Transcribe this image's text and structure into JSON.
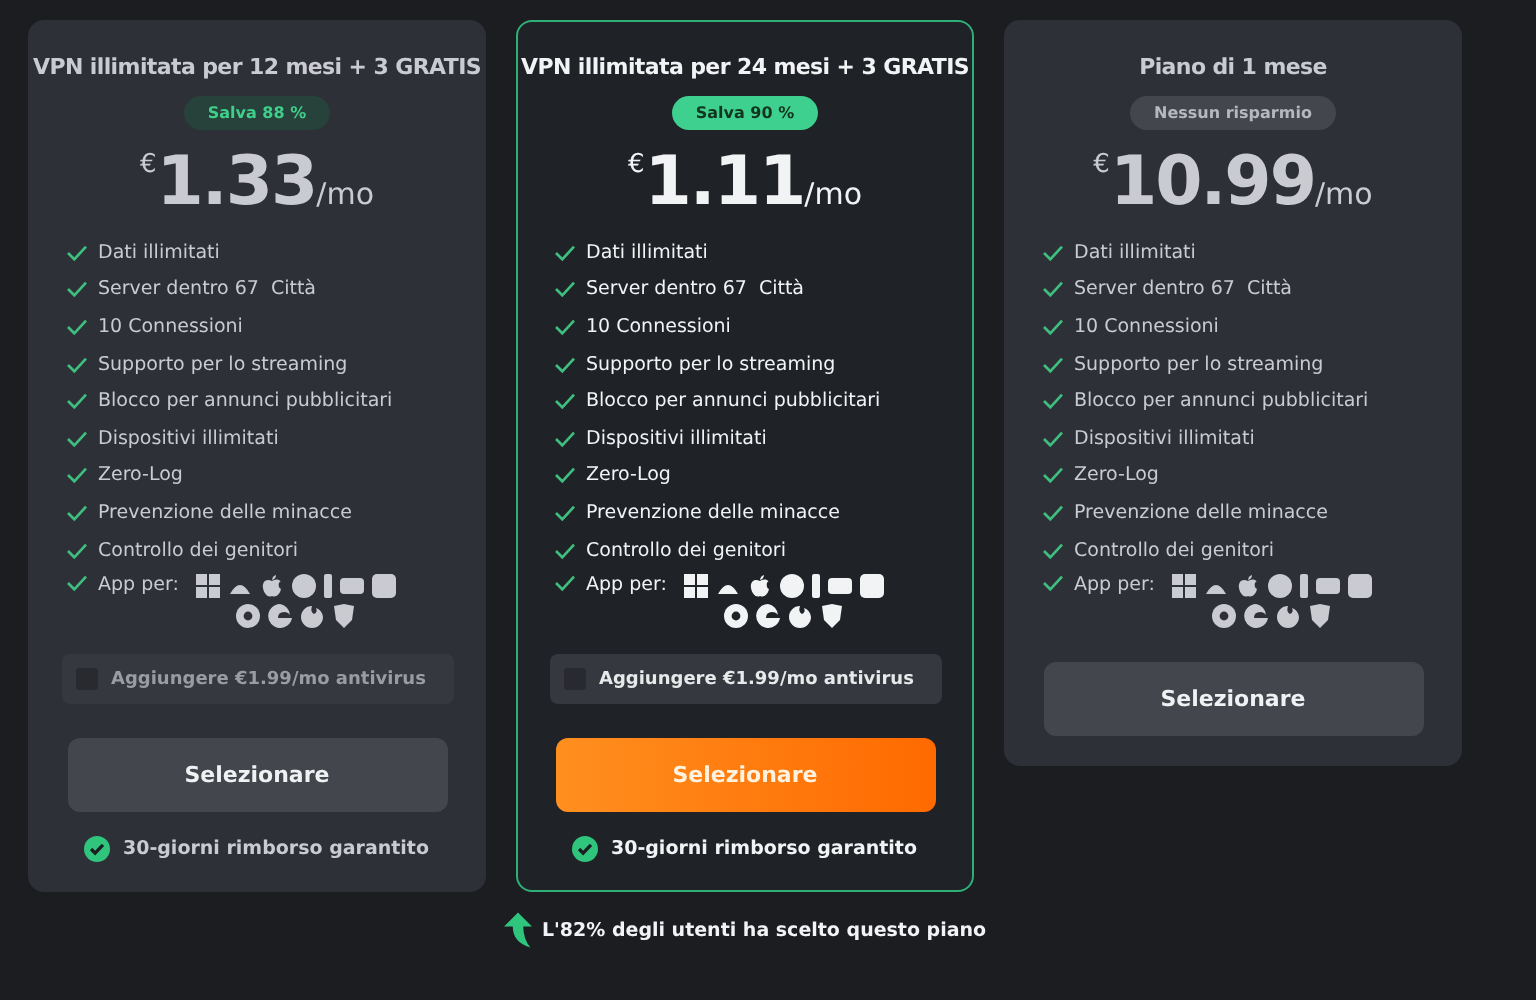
{
  "plans": [
    {
      "title": "VPN illimitata per 12 mesi + 3 GRATIS",
      "selected": false,
      "badge": {
        "text": "Salva 88 %",
        "kind": "saving"
      },
      "currency": "€",
      "amount": "1.33",
      "unit": "/mo",
      "features": [
        "Dati illimitati",
        "Server dentro 67  Città",
        "10 Connessioni",
        "Supporto per lo streaming",
        "Blocco per annunci pubblicitari",
        "Dispositivi illimitati",
        "Zero-Log",
        "Prevenzione delle minacce",
        "Controllo dei genitori"
      ],
      "apps_label": "App per:",
      "antivirus": {
        "label": "Aggiungere €1.99/mo antivirus",
        "checked": false
      },
      "button": "Selezionare",
      "guarantee": "30-giorni rimborso garantito"
    },
    {
      "title": "VPN illimitata per 24 mesi + 3 GRATIS",
      "selected": true,
      "badge": {
        "text": "Salva 90 %",
        "kind": "saving"
      },
      "currency": "€",
      "amount": "1.11",
      "unit": "/mo",
      "features": [
        "Dati illimitati",
        "Server dentro 67  Città",
        "10 Connessioni",
        "Supporto per lo streaming",
        "Blocco per annunci pubblicitari",
        "Dispositivi illimitati",
        "Zero-Log",
        "Prevenzione delle minacce",
        "Controllo dei genitori"
      ],
      "apps_label": "App per:",
      "antivirus": {
        "label": "Aggiungere €1.99/mo antivirus",
        "checked": false
      },
      "button": "Selezionare",
      "guarantee": "30-giorni rimborso garantito",
      "note": "L'82% degli utenti ha scelto questo piano"
    },
    {
      "title": "Piano di 1 mese",
      "selected": false,
      "badge": {
        "text": "Nessun risparmio",
        "kind": "none"
      },
      "currency": "€",
      "amount": "10.99",
      "unit": "/mo",
      "features": [
        "Dati illimitati",
        "Server dentro 67  Città",
        "10 Connessioni",
        "Supporto per lo streaming",
        "Blocco per annunci pubblicitari",
        "Dispositivi illimitati",
        "Zero-Log",
        "Prevenzione delle minacce",
        "Controllo dei genitori"
      ],
      "apps_label": "App per:",
      "button": "Selezionare"
    }
  ]
}
